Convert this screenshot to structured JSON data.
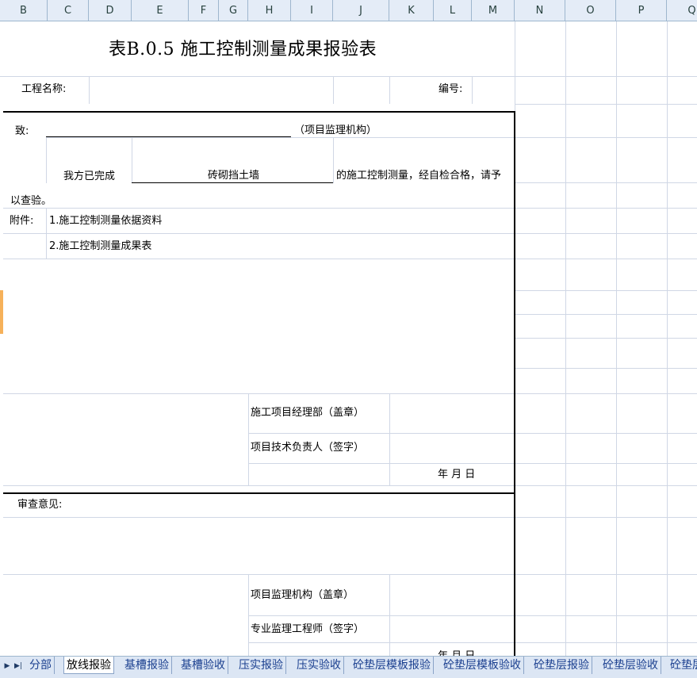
{
  "columns": [
    "B",
    "C",
    "D",
    "E",
    "F",
    "G",
    "H",
    "I",
    "J",
    "K",
    "L",
    "M",
    "N",
    "O",
    "P",
    "Q"
  ],
  "form": {
    "title": "表B.0.5 施工控制测量成果报验表",
    "project_name_label": "工程名称:",
    "serial_label": "编号:",
    "to_label": "致:",
    "supervisor_org_paren": "（项目监理机构）",
    "completed_prefix": "我方已完成",
    "work_item": "砖砌挡土墙",
    "completed_suffix": "的施工控制测量，经自检合格，请予",
    "inspect_text": "以查验。",
    "attachment_label": "附件:",
    "attachment_1": "1.施工控制测量依据资料",
    "attachment_2": "2.施工控制测量成果表",
    "contractor_dept": "施工项目经理部（盖章）",
    "tech_lead": "项目技术负责人（签字）",
    "date_label": "年    月    日",
    "review_label": "审查意见:",
    "supervisor_org": "项目监理机构（盖章）",
    "supervisor_engineer": "专业监理工程师（签字）",
    "date_label_2": "年    月    日"
  },
  "sheet_tabs": [
    "分部",
    "放线报验",
    "基槽报验",
    "基槽验收",
    "压实报验",
    "压实验收",
    "砼垫层模板报验",
    "砼垫层模板验收",
    "砼垫层报验",
    "砼垫层验收",
    "砼垫层"
  ],
  "active_tab": "放线报验"
}
